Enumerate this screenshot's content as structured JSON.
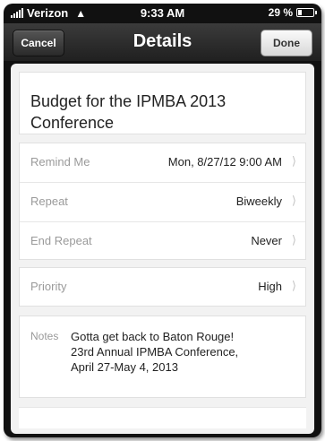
{
  "status": {
    "carrier": "Verizon",
    "time": "9:33 AM",
    "battery": "29 %",
    "battery_level": 0.29
  },
  "nav": {
    "cancel": "Cancel",
    "title": "Details",
    "done": "Done"
  },
  "reminder": {
    "title": "Budget for the IPMBA 2013 Conference"
  },
  "rows": [
    {
      "label": "Remind Me",
      "value": "Mon, 8/27/12 9:00 AM"
    },
    {
      "label": "Repeat",
      "value": "Biweekly"
    },
    {
      "label": "End Repeat",
      "value": "Never"
    }
  ],
  "priority": {
    "label": "Priority",
    "value": "High"
  },
  "notes": {
    "label": "Notes",
    "lines": [
      "Gotta get back to Baton Rouge!",
      "23rd Annual IPMBA Conference,",
      "April 27-May 4, 2013"
    ]
  },
  "icons": {
    "chevron": "chevron-right-icon",
    "wifi": "wifi-icon",
    "signal": "signal-icon",
    "battery": "battery-icon"
  }
}
